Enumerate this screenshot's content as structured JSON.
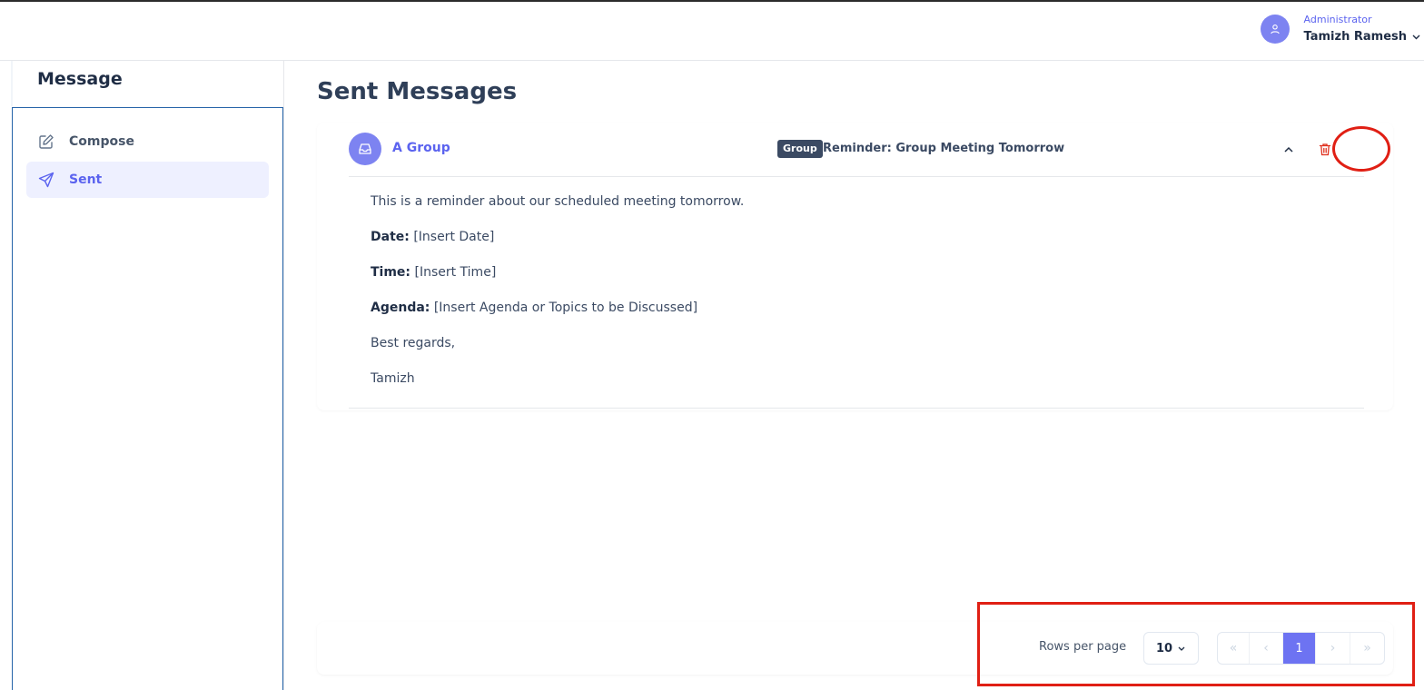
{
  "header": {
    "user_role": "Administrator",
    "user_name": "Tamizh Ramesh",
    "avatar_icon": "user-icon"
  },
  "sidebar": {
    "title": "Message",
    "items": [
      {
        "label": "Compose",
        "icon": "edit-icon",
        "active": false
      },
      {
        "label": "Sent",
        "icon": "send-icon",
        "active": true
      }
    ]
  },
  "main": {
    "title": "Sent Messages",
    "message": {
      "recipient": "A Group",
      "badge": "Group",
      "subject": "Reminder: Group Meeting Tomorrow",
      "body": {
        "intro": "This is a reminder about our scheduled meeting tomorrow.",
        "date_label": "Date:",
        "date_value": "[Insert Date]",
        "time_label": "Time:",
        "time_value": "[Insert Time]",
        "agenda_label": "Agenda:",
        "agenda_value": "[Insert Agenda or Topics to be Discussed]",
        "closing": "Best regards,",
        "signature": "Tamizh"
      }
    }
  },
  "pagination": {
    "rows_label": "Rows per page",
    "rows_value": "10",
    "first": "«",
    "prev": "‹",
    "current_page": "1",
    "next": "›",
    "last": "»"
  },
  "colors": {
    "accent": "#5b63ef",
    "annotation": "#e01f14"
  }
}
